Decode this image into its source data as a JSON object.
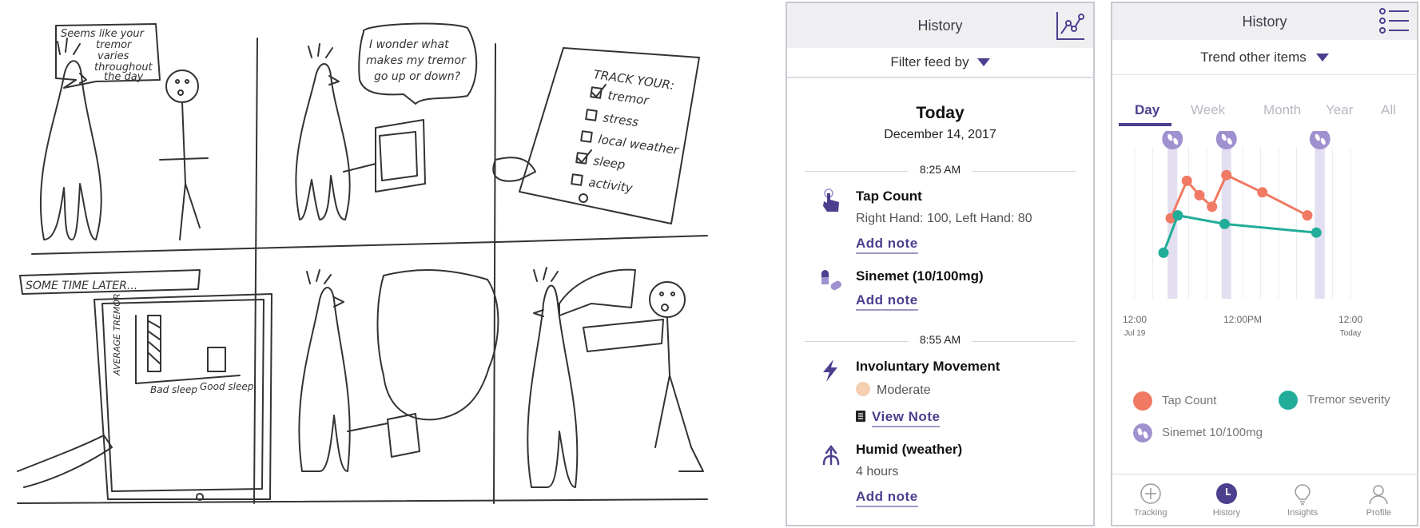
{
  "storyboard": {
    "panel1_bubble": [
      "Seems like your",
      "tremor",
      "varies",
      "throughout",
      "the day"
    ],
    "panel2_bubble": [
      "I wonder what",
      "makes my tremor",
      "go up or down?"
    ],
    "panel3_title": "TRACK YOUR:",
    "panel3_items": [
      {
        "label": "tremor",
        "checked": true
      },
      {
        "label": "stress",
        "checked": false
      },
      {
        "label": "local weather",
        "checked": false
      },
      {
        "label": "sleep",
        "checked": true
      },
      {
        "label": "activity",
        "checked": false
      }
    ],
    "panel4_caption": "SOME TIME LATER...",
    "panel4_ylabel": "AVERAGE TREMOR",
    "panel4_bars": [
      "Bad sleep",
      "Good sleep"
    ]
  },
  "history_screen": {
    "title": "History",
    "graph_icon": "line-graph-icon",
    "filter_label": "Filter feed by",
    "day_heading": "Today",
    "date": "December 14, 2017",
    "groups": [
      {
        "time": "8:25 AM",
        "entries": [
          {
            "icon": "tap-hand-icon",
            "name": "Tap Count",
            "detail": "Right Hand: 100, Left Hand: 80",
            "link": "Add note"
          },
          {
            "icon": "pills-icon",
            "name": "Sinemet (10/100mg)",
            "detail": "",
            "link": "Add note"
          }
        ]
      },
      {
        "time": "8:55 AM",
        "entries": [
          {
            "icon": "lightning-icon",
            "name": "Involuntary Movement",
            "detail": "Moderate",
            "link": "View Note"
          },
          {
            "icon": "humidity-icon",
            "name": "Humid (weather)",
            "detail": "4 hours",
            "link": "Add note"
          }
        ]
      }
    ]
  },
  "trend_screen": {
    "title": "History",
    "menu_icon": "list-menu-icon",
    "trend_label": "Trend other items",
    "tabs": [
      "Day",
      "Week",
      "Month",
      "Year",
      "All"
    ],
    "active_tab": "Day",
    "x_ticks": [
      {
        "label": "12:00",
        "sub": "Jul 19"
      },
      {
        "label": "12:00PM",
        "sub": ""
      },
      {
        "label": "12:00",
        "sub": "Today"
      }
    ],
    "legend": [
      {
        "label": "Tap Count",
        "color": "#f07a64"
      },
      {
        "label": "Tremor severity",
        "color": "#22ad9a"
      },
      {
        "label": "Sinemet 10/100mg",
        "color": "#9f91cf"
      }
    ],
    "nav": [
      {
        "label": "Tracking",
        "icon": "plus-circle-icon",
        "active": false
      },
      {
        "label": "History",
        "icon": "clock-icon",
        "active": true
      },
      {
        "label": "Insights",
        "icon": "lightbulb-icon",
        "active": false
      },
      {
        "label": "Profile",
        "icon": "person-icon",
        "active": false
      }
    ]
  },
  "chart_data": {
    "type": "line",
    "x_unit": "hours from 12:00 Jul 19",
    "x_range": [
      0,
      24
    ],
    "series": [
      {
        "name": "Tap Count",
        "color": "#f07a64",
        "points": [
          [
            4,
            5.6
          ],
          [
            5.8,
            8.2
          ],
          [
            7.2,
            7.2
          ],
          [
            8.6,
            6.4
          ],
          [
            10.2,
            8.6
          ],
          [
            14.2,
            7.4
          ],
          [
            19.2,
            5.8
          ]
        ]
      },
      {
        "name": "Tremor severity",
        "color": "#22ad9a",
        "points": [
          [
            3.2,
            3.2
          ],
          [
            4.8,
            5.8
          ],
          [
            10.0,
            5.2
          ],
          [
            20.2,
            4.6
          ]
        ]
      }
    ],
    "medication_markers": {
      "name": "Sinemet 10/100mg",
      "color": "#9f91cf",
      "x": [
        4.2,
        10.2,
        20.6
      ]
    }
  }
}
